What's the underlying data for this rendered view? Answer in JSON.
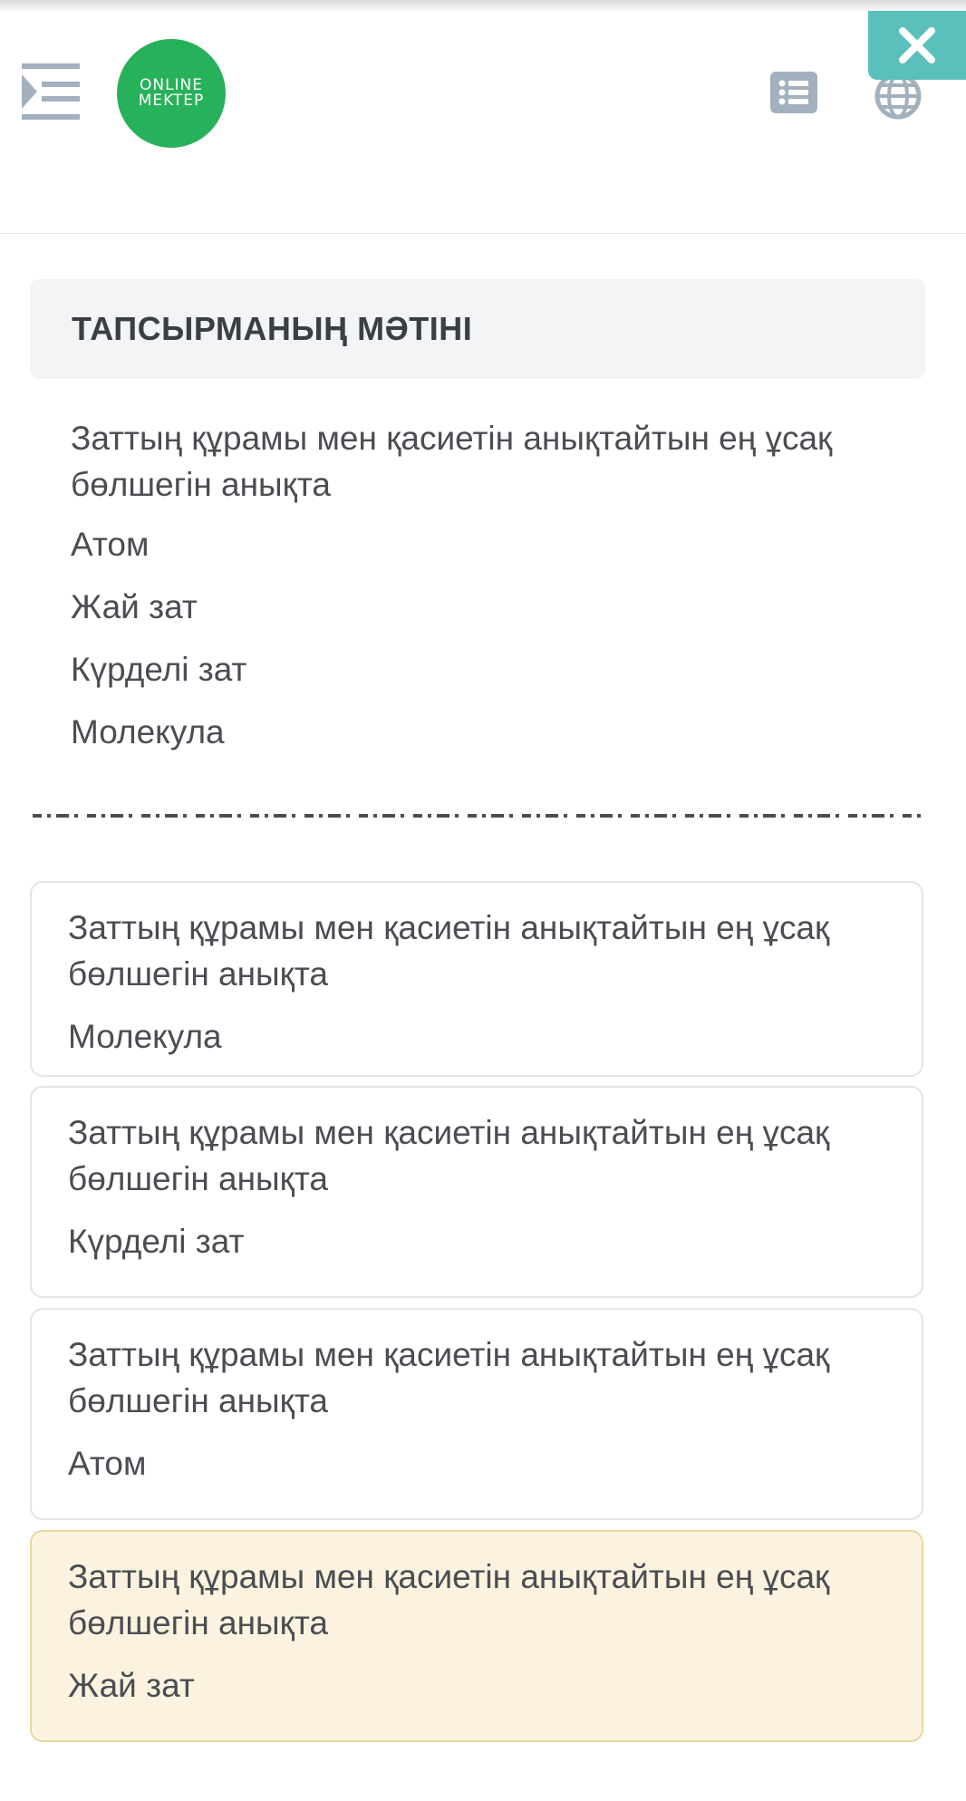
{
  "header": {
    "logo_line1": "ONLINE",
    "logo_line2": "MEKTEP",
    "menu_icon": "menu-toggle-icon",
    "list_icon": "list-icon",
    "globe_icon": "globe-icon",
    "close_icon": "close-icon",
    "colors": {
      "logo": "#27b15a",
      "close": "#5bbfbb",
      "icon": "#a3b1be"
    }
  },
  "task": {
    "title": "ТАПСЫРМАНЫҢ МӘТІНІ",
    "question": "Заттың құрамы мен қасиетін анықтайтын ең ұсақ бөлшегін анықта",
    "options": [
      "Атом",
      "Жай зат",
      "Күрделі зат",
      "Молекула"
    ]
  },
  "answers": [
    {
      "question": "Заттың құрамы мен қасиетін анықтайтын ең ұсақ бөлшегін анықта",
      "answer": "Молекула",
      "highlighted": false
    },
    {
      "question": "Заттың құрамы мен қасиетін анықтайтын ең ұсақ бөлшегін анықта",
      "answer": "Күрделі зат",
      "highlighted": false
    },
    {
      "question": "Заттың құрамы мен қасиетін анықтайтын ең ұсақ бөлшегін анықта",
      "answer": "Атом",
      "highlighted": false
    },
    {
      "question": "Заттың құрамы мен қасиетін анықтайтын ең ұсақ бөлшегін анықта",
      "answer": "Жай зат",
      "highlighted": true
    }
  ]
}
